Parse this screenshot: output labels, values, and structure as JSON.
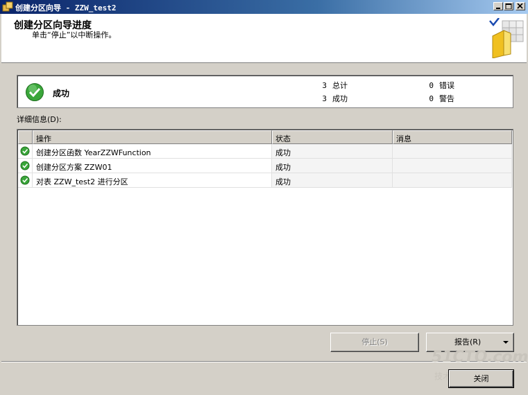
{
  "window": {
    "title": "创建分区向导 - ZZW_test2"
  },
  "header": {
    "title": "创建分区向导进度",
    "subtitle": "单击“停止”以中断操作。"
  },
  "summary": {
    "status": "成功",
    "stats": [
      {
        "count": "3",
        "label": "总计"
      },
      {
        "count": "3",
        "label": "成功"
      },
      {
        "count": "0",
        "label": "错误"
      },
      {
        "count": "0",
        "label": "警告"
      }
    ]
  },
  "details": {
    "label": "详细信息(D):",
    "columns": [
      "操作",
      "状态",
      "消息"
    ],
    "rows": [
      {
        "action": "创建分区函数 YearZZWFunction",
        "status": "成功",
        "message": ""
      },
      {
        "action": "创建分区方案 ZZW01",
        "status": "成功",
        "message": ""
      },
      {
        "action": "对表 ZZW_test2 进行分区",
        "status": "成功",
        "message": ""
      }
    ]
  },
  "buttons": {
    "stop": "停止(S)",
    "report": "报告(R)",
    "close": "关闭"
  },
  "colors": {
    "title_bar": "#0a246a",
    "success": "#3aa63a",
    "face": "#d4d0c8"
  },
  "watermark": {
    "line1": "51CTO.com",
    "line2": "技术博客 Blog"
  }
}
